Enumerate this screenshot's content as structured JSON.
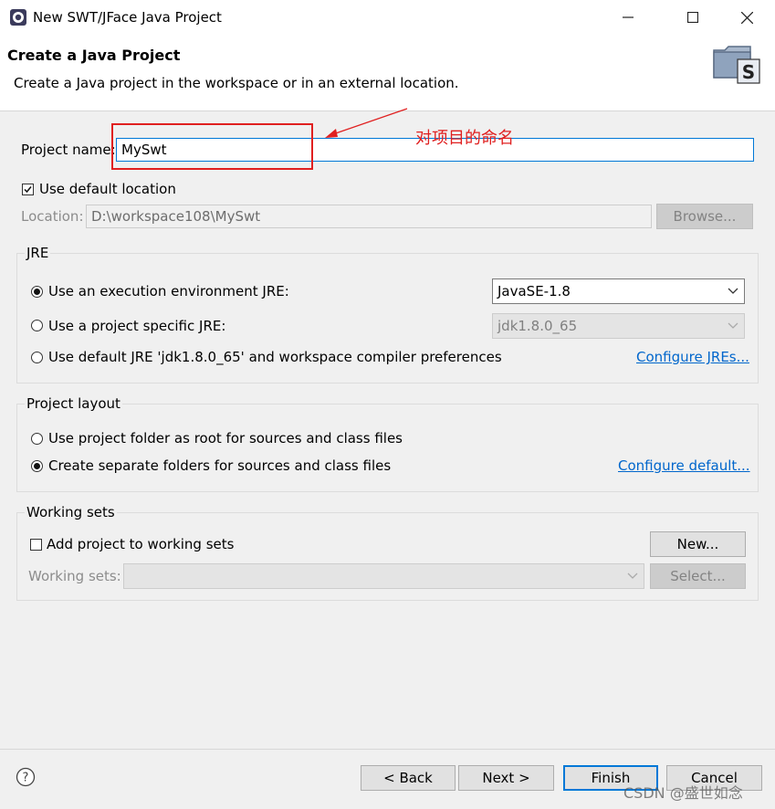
{
  "window": {
    "title": "New SWT/JFace Java Project",
    "minimize_icon": "minimize-icon",
    "maximize_icon": "maximize-icon",
    "close_icon": "close-icon"
  },
  "header": {
    "title": "Create a Java Project",
    "description": "Create a Java project in the workspace or in an external location."
  },
  "project_name": {
    "label": "Project name:",
    "value": "MySwt",
    "annotation": "对项目的命名",
    "annotation_color": "#e02020"
  },
  "location": {
    "use_default_label": "Use default location",
    "use_default_checked": true,
    "label": "Location:",
    "value": "D:\\workspace108\\MySwt",
    "browse_label": "Browse..."
  },
  "jre": {
    "title": "JRE",
    "option_env_label": "Use an execution environment JRE:",
    "option_env_selected": true,
    "env_combo_value": "JavaSE-1.8",
    "option_specific_label": "Use a project specific JRE:",
    "specific_combo_value": "jdk1.8.0_65",
    "option_default_label": "Use default JRE 'jdk1.8.0_65' and workspace compiler preferences",
    "configure_link": "Configure JREs..."
  },
  "layout": {
    "title": "Project layout",
    "option_root_label": "Use project folder as root for sources and class files",
    "option_separate_label": "Create separate folders for sources and class files",
    "option_separate_selected": true,
    "configure_link": "Configure default..."
  },
  "working_sets": {
    "title": "Working sets",
    "add_label": "Add project to working sets",
    "add_checked": false,
    "new_label": "New...",
    "sets_label": "Working sets:",
    "select_label": "Select..."
  },
  "footer": {
    "help_icon": "help-icon",
    "back_label": "< Back",
    "next_label": "Next >",
    "finish_label": "Finish",
    "cancel_label": "Cancel"
  },
  "watermark": "CSDN @盛世如念",
  "colors": {
    "accent": "#0078d7",
    "link": "#0066cc",
    "annotation": "#e02020"
  }
}
